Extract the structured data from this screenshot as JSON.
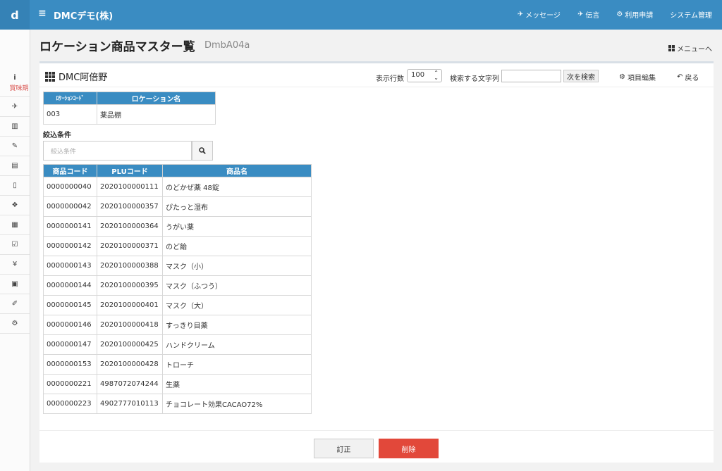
{
  "topbar": {
    "brand": "d",
    "company": "DMCデモ(株)",
    "nav": [
      "メッセージ",
      "伝言",
      "利用申請",
      "システム管理"
    ]
  },
  "sidebar": {
    "first_label": "賞味期",
    "icons": [
      "info-icon",
      "send-icon",
      "bar-chart-icon",
      "edit-icon",
      "clipboard-icon",
      "file-icon",
      "cubes-icon",
      "calendar-icon",
      "calendar-check-icon",
      "yen-icon",
      "briefcase-icon",
      "wrench-icon",
      "gears-icon"
    ]
  },
  "page": {
    "title": "ロケーション商品マスター覧",
    "code": "DmbA04a",
    "menu_link": "メニューへ"
  },
  "toolbar": {
    "store": "DMC阿倍野",
    "rows_label": "表示行数",
    "rows_value": "100",
    "search_label": "検索する文字列",
    "search_value": "",
    "next_button": "次を検索",
    "edit_link": "項目編集",
    "back_link": "戻る"
  },
  "location": {
    "headers": [
      "ﾛｹｰｼｮﾝｺｰﾄﾞ",
      "ロケーション名"
    ],
    "code": "003",
    "name": "薬品棚"
  },
  "filter": {
    "label": "絞込条件",
    "placeholder": "絞込条件"
  },
  "products": {
    "headers": [
      "商品コード",
      "PLUコード",
      "商品名"
    ],
    "rows": [
      [
        "0000000040",
        "2020100000111",
        "のどかぜ薬 48錠"
      ],
      [
        "0000000042",
        "2020100000357",
        "ぴたっと湿布"
      ],
      [
        "0000000141",
        "2020100000364",
        "うがい薬"
      ],
      [
        "0000000142",
        "2020100000371",
        "のど飴"
      ],
      [
        "0000000143",
        "2020100000388",
        "マスク（小）"
      ],
      [
        "0000000144",
        "2020100000395",
        "マスク（ふつう）"
      ],
      [
        "0000000145",
        "2020100000401",
        "マスク（大）"
      ],
      [
        "0000000146",
        "2020100000418",
        "すっきり目薬"
      ],
      [
        "0000000147",
        "2020100000425",
        "ハンドクリーム"
      ],
      [
        "0000000153",
        "2020100000428",
        "トローチ"
      ],
      [
        "0000000221",
        "4987072074244",
        "生薬"
      ],
      [
        "0000000223",
        "4902777010113",
        "チョコレート効果CACAO72%"
      ]
    ]
  },
  "footer": {
    "correct_button": "訂正",
    "delete_button": "削除"
  },
  "colors": {
    "header_blue": "#3a8cc2",
    "delete_red": "#e2483a"
  }
}
